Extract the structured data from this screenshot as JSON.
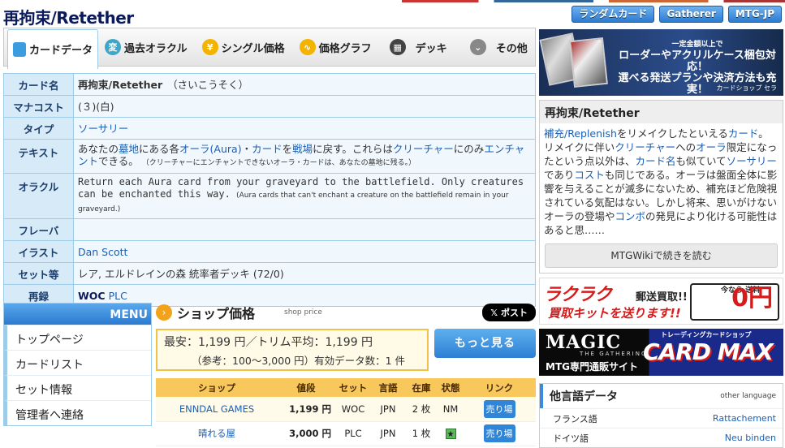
{
  "page": {
    "title": "再拘束/Retether"
  },
  "top_buttons": [
    "ランダムカード",
    "Gatherer",
    "MTG-JP"
  ],
  "tabs": [
    {
      "label": "カードデータ",
      "icon": "card-icon"
    },
    {
      "label": "過去オラクル",
      "icon": "hen-icon"
    },
    {
      "label": "シングル価格",
      "icon": "yen-icon"
    },
    {
      "label": "価格グラフ",
      "icon": "graph-icon"
    },
    {
      "label": "デッキ",
      "icon": "deck-icon"
    },
    {
      "label": "その他",
      "icon": "chevron-down-icon"
    }
  ],
  "card": {
    "labels": {
      "name": "カード名",
      "mana": "マナコスト",
      "type": "タイプ",
      "text": "テキスト",
      "oracle": "オラクル",
      "flavor": "フレーバ",
      "illust": "イラスト",
      "set": "セット等",
      "reprint": "再録"
    },
    "name": "再拘束/Retether",
    "name_kana": "（さいこうそく）",
    "mana": "(３)(白)",
    "type": "ソーサリー",
    "text_parts": {
      "p1": "あなたの",
      "graveyard": "墓地",
      "p2": "にある各",
      "aura": "オーラ(Aura)",
      "p3": "・",
      "cardword": "カード",
      "p4": "を",
      "battlefield": "戦場",
      "p5": "に戻す。これらは",
      "creature": "クリーチャー",
      "p6": "にのみ",
      "enchant": "エンチャント",
      "p7": "できる。"
    },
    "text_note": "（クリーチャーにエンチャントできないオーラ・カードは、あなたの墓地に残る。）",
    "oracle": "Return each Aura card from your graveyard to the battlefield. Only creatures can be enchanted this way.",
    "oracle_note": "(Aura cards that can't enchant a creature on the battlefield remain in your graveyard.)",
    "flavor": "",
    "illustrator": "Dan Scott",
    "set": "レア, エルドレインの森 統率者デッキ (72/0)",
    "reprint_1": "WOC",
    "reprint_2": "PLC"
  },
  "menu": {
    "header": "MENU",
    "items": [
      "トップページ",
      "カードリスト",
      "セット情報",
      "管理者へ連絡"
    ]
  },
  "shop": {
    "title": "ショップ価格",
    "subtitle": "shop price",
    "post": "𝕏 ポスト",
    "line1": "最安：1,199 円／トリム平均：1,199 円",
    "line2": "（参考：100～3,000 円）有効データ数：1 件",
    "more": "もっと見る",
    "headers": [
      "ショップ",
      "値段",
      "セット",
      "言語",
      "在庫",
      "状態",
      "リンク"
    ],
    "rows": [
      {
        "shop": "ENNDAL GAMES",
        "price": "1,199 円",
        "set": "WOC",
        "lang": "JPN",
        "stock": "2 枚",
        "cond": "NM",
        "link": "売り場"
      },
      {
        "shop": "晴れる屋",
        "price": "3,000 円",
        "set": "PLC",
        "lang": "JPN",
        "stock": "1 枚",
        "cond": "★",
        "link": "売り場"
      }
    ]
  },
  "ad1": {
    "line1": "一定金額以上で",
    "line2": "ローダーやアクリルケース梱包対応！",
    "line3": "選べる発送プランや決済方法も充実！",
    "brand": "カードショップ セラ"
  },
  "wiki": {
    "title": "再拘束/Retether",
    "t1": "補充/Replenish",
    "t2": "をリメイクしたといえる",
    "t3": "カード",
    "t4": "。リメイクに伴い",
    "t5": "クリーチャー",
    "t6": "への",
    "t7": "オーラ",
    "t8": "限定になったという点以外は、",
    "t9": "カード名",
    "t10": "も似ていて",
    "t11": "ソーサリー",
    "t12": "であり",
    "t13": "コスト",
    "t14": "も同じである。オーラは盤面全体に影響を与えることが滅多にないため、補充ほど危険視されている気配はない。しかし将来、思いがけないオーラの登場や",
    "t15": "コンボ",
    "t16": "の発見により化ける可能性はあると思……",
    "button": "MTGWikiで続きを読む"
  },
  "ad2": {
    "t1": "ラクラク",
    "t1b": "郵送買取!!",
    "t2": "買取キットを送ります!!",
    "truck_label": "今なら 送料",
    "zero": "0円"
  },
  "ad3": {
    "magic": "MAGIC",
    "gathering": "THE GATHERING",
    "sub": "MTG専門通販サイト",
    "top": "トレーディングカードショップ",
    "max": "CARD MAX"
  },
  "lang": {
    "title": "他言語データ",
    "sub": "other language",
    "rows": [
      {
        "lang": "フランス語",
        "name": "Rattachement"
      },
      {
        "lang": "ドイツ語",
        "name": "Neu binden"
      }
    ]
  },
  "colors": {
    "accent": "#2d7bd0",
    "table_header": "#d6eaf8",
    "shop_header": "#f8c85c"
  }
}
